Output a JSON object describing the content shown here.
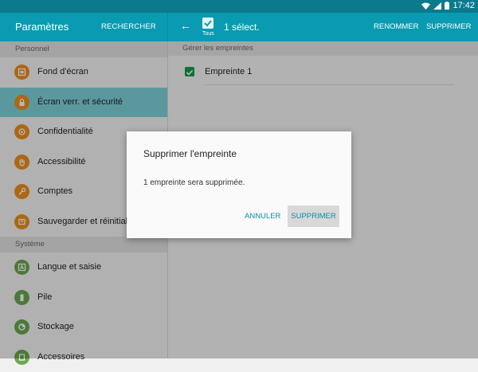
{
  "status_bar": {
    "time": "17:42"
  },
  "app_bar": {
    "title": "Paramètres",
    "search_label": "RECHERCHER",
    "select_all_label": "Tous",
    "selected_count": "1 sélect.",
    "rename_label": "RENOMMER",
    "delete_label": "SUPPRIMER"
  },
  "sidebar": {
    "sections": [
      {
        "header": "Personnel",
        "items": [
          {
            "label": "Fond d'écran",
            "icon": "wallpaper-icon"
          },
          {
            "label": "Écran verr. et sécurité",
            "icon": "lock-icon",
            "active": true
          },
          {
            "label": "Confidentialité",
            "icon": "privacy-icon"
          },
          {
            "label": "Accessibilité",
            "icon": "hand-icon"
          },
          {
            "label": "Comptes",
            "icon": "key-icon"
          },
          {
            "label": "Sauvegarder et réinitialis",
            "icon": "backup-icon"
          }
        ]
      },
      {
        "header": "Système",
        "items": [
          {
            "label": "Langue et saisie",
            "icon": "language-icon"
          },
          {
            "label": "Pile",
            "icon": "battery-icon"
          },
          {
            "label": "Stockage",
            "icon": "storage-icon"
          },
          {
            "label": "Accessoires",
            "icon": "accessories-icon"
          }
        ]
      }
    ]
  },
  "main": {
    "header": "Gérer les empreintes",
    "fingerprints": [
      {
        "label": "Empreinte 1",
        "checked": true
      }
    ]
  },
  "dialog": {
    "title": "Supprimer l'empreinte",
    "message": "1 empreinte sera supprimée.",
    "cancel_label": "ANNULER",
    "confirm_label": "SUPPRIMER"
  },
  "colors": {
    "status_bar": "#0a7a8c",
    "app_bar": "#0a9bb2",
    "active_item": "#7fd3dc",
    "accent_text": "#0a8fa5",
    "checkbox": "#14a04a",
    "icon_orange": "#ef8f1d",
    "icon_green": "#6aa84f"
  }
}
